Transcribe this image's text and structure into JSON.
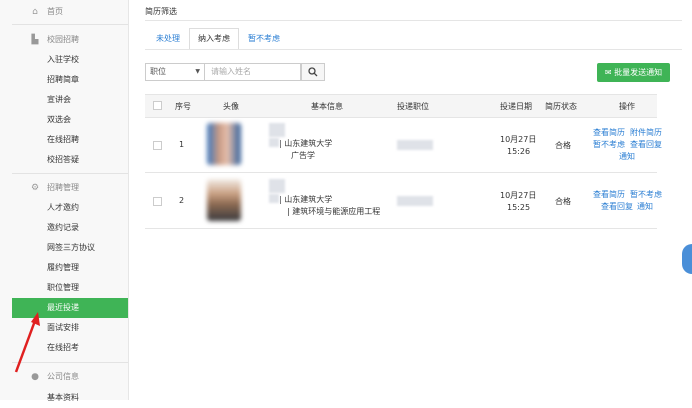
{
  "sidebar": {
    "home": "首页",
    "section1": "校园招聘",
    "s1items": [
      "入驻学校",
      "招聘简章",
      "宣讲会",
      "双选会",
      "在线招聘",
      "校招答疑"
    ],
    "section2": "招聘管理",
    "s2items": [
      "人才邀约",
      "邀约记录",
      "网签三方协议",
      "履约管理",
      "职位管理",
      "最近投递",
      "面试安排",
      "在线招考"
    ],
    "active": "最近投递",
    "section3": "公司信息",
    "s3items": [
      "基本资料"
    ]
  },
  "main": {
    "title": "简历筛选",
    "tabs": [
      "未处理",
      "纳入考虑",
      "暂不考虑"
    ],
    "active_tab": "纳入考虑",
    "filter": {
      "select_value": "职位",
      "search_placeholder": "请输入姓名",
      "search_icon": "search-icon"
    },
    "bulk_button": "批量发送通知",
    "columns": [
      "序号",
      "头像",
      "基本信息",
      "投递职位",
      "投递日期",
      "简历状态",
      "操作"
    ],
    "rows": [
      {
        "no": "1",
        "school": "| 山东建筑大学",
        "major": "广告学",
        "date1": "10月27日",
        "date2": "15:26",
        "status": "合格",
        "ops": [
          "查看简历",
          "附件简历",
          "暂不考虑",
          "查看回复",
          "通知"
        ]
      },
      {
        "no": "2",
        "school": "| 山东建筑大学",
        "major": "| 建筑环境与能源应用工程",
        "date1": "10月27日",
        "date2": "15:25",
        "status": "合格",
        "ops": [
          "查看简历",
          "暂不考虑",
          "查看回复",
          "通知"
        ]
      }
    ]
  },
  "colors": {
    "accent": "#3fb456",
    "link": "#2a7ed3",
    "annotation_arrow": "#e02020"
  }
}
